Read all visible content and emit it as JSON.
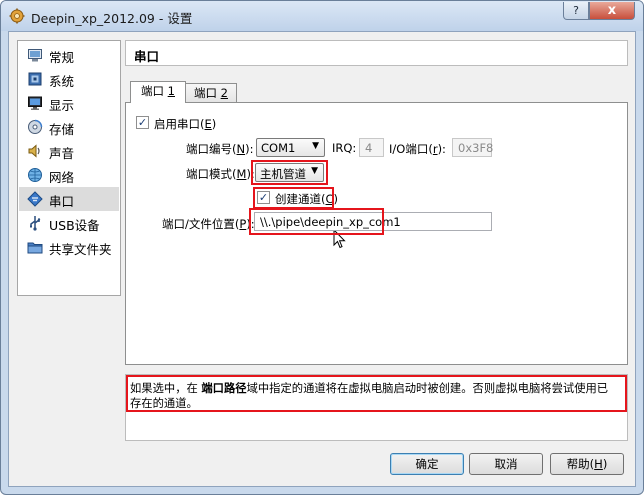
{
  "window": {
    "title": "Deepin_xp_2012.09 - 设置"
  },
  "titlebar_buttons": {
    "help": "?",
    "close": "x"
  },
  "sidebar": {
    "items": [
      {
        "label": "常规",
        "icon": "general-settings-icon"
      },
      {
        "label": "系统",
        "icon": "system-icon"
      },
      {
        "label": "显示",
        "icon": "display-icon"
      },
      {
        "label": "存储",
        "icon": "storage-icon"
      },
      {
        "label": "声音",
        "icon": "audio-icon"
      },
      {
        "label": "网络",
        "icon": "network-icon"
      },
      {
        "label": "串口",
        "icon": "serial-port-icon",
        "selected": true
      },
      {
        "label": "USB设备",
        "icon": "usb-icon"
      },
      {
        "label": "共享文件夹",
        "icon": "shared-folder-icon"
      }
    ]
  },
  "page": {
    "title": "串口"
  },
  "tabs": [
    {
      "prefix": "端口 ",
      "mnemonic": "1",
      "active": true
    },
    {
      "prefix": "端口 ",
      "mnemonic": "2",
      "active": false
    }
  ],
  "port": {
    "enable": {
      "label": "启用串口",
      "mnemonic": "E",
      "checked": true
    },
    "number": {
      "label": "端口编号",
      "mnemonic": "N",
      "value": "COM1"
    },
    "irq": {
      "label": "IRQ:",
      "value": "4"
    },
    "io": {
      "label": "I/O端口",
      "mnemonic": "r",
      "value": "0x3F8"
    },
    "mode": {
      "label": "端口模式",
      "mnemonic": "M",
      "value": "主机管道"
    },
    "create_pipe": {
      "label": "创建通道",
      "mnemonic": "C",
      "checked": true
    },
    "path": {
      "label": "端口/文件位置",
      "mnemonic": "P",
      "value": "\\\\.\\pipe\\deepin_xp_com1"
    }
  },
  "info": {
    "before": "如果选中，在 ",
    "bold": "端口路径",
    "after": "域中指定的通道将在虚拟电脑启动时被创建。否则虚拟电脑将尝试使用已存在的通道。"
  },
  "buttons": {
    "ok": {
      "label": "确定"
    },
    "cancel": {
      "label": "取消"
    },
    "help": {
      "label": "帮助",
      "mnemonic": "H"
    }
  },
  "colors": {
    "highlight": "#e5151c",
    "selection": "#dcdcdc",
    "frame": "#c9d9ec"
  }
}
